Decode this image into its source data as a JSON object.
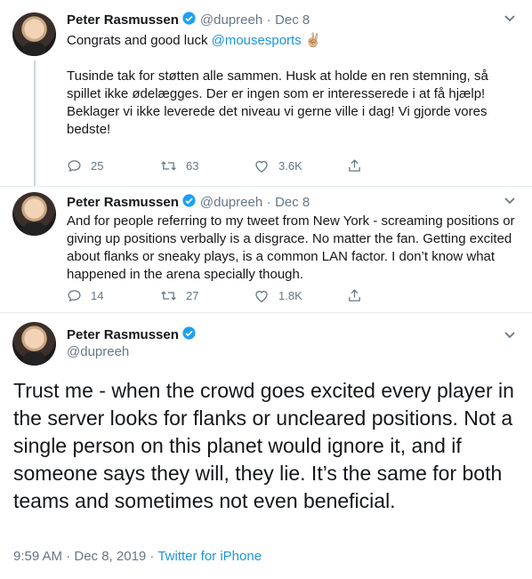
{
  "tweets": [
    {
      "name": "Peter Rasmussen",
      "handle": "@dupreeh",
      "sep": "·",
      "date": "Dec 8",
      "text_pre": "Congrats and good luck ",
      "mention": "@mousesports",
      "emoji": "✌🏼",
      "body": "Tusinde tak for støtten alle sammen. Husk at holde en ren stemning, så spillet ikke ødelægges. Der er ingen som er interesserede i at få hjælp!\nBeklager vi ikke leverede det niveau vi gerne ville i dag! Vi gjorde vores bedste!",
      "replies": "25",
      "retweets": "63",
      "likes": "3.6K"
    },
    {
      "name": "Peter Rasmussen",
      "handle": "@dupreeh",
      "sep": "·",
      "date": "Dec 8",
      "body": "And for people referring to my tweet from New York - screaming positions or giving up positions verbally is a disgrace. No matter the fan. Getting excited about flanks or sneaky plays, is a common LAN factor. I don’t know what happened in the arena specially though.",
      "replies": "14",
      "retweets": "27",
      "likes": "1.8K"
    }
  ],
  "main_tweet": {
    "name": "Peter Rasmussen",
    "handle": "@dupreeh",
    "body": "Trust me - when the crowd goes excited every player in the server looks for flanks or uncleared positions. Not a single person on this planet would ignore it, and if someone says they will, they lie. It’s the same for both teams and sometimes not even beneficial.",
    "time": "9:59 AM · Dec 8, 2019 ·",
    "source": "Twitter for iPhone"
  },
  "colors": {
    "accent": "#1b95e0",
    "muted": "#657786",
    "verified": "#1da1f2"
  },
  "icons": [
    "reply-icon",
    "retweet-icon",
    "like-icon",
    "share-icon",
    "verified-icon",
    "chevron-down-icon"
  ]
}
